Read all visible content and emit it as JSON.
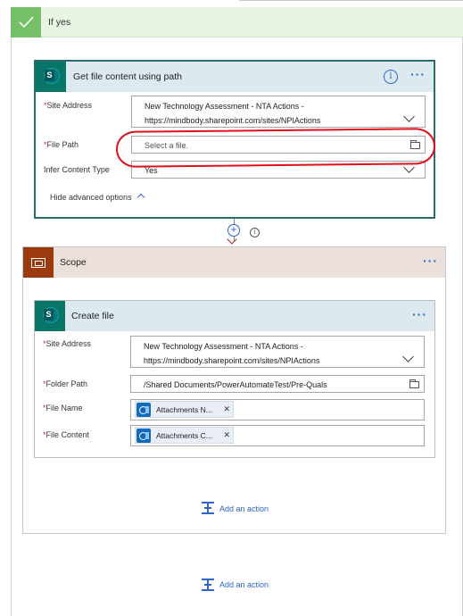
{
  "if_yes": {
    "title": "If yes"
  },
  "get_file_content": {
    "title": "Get file content using path",
    "site_address_label": "Site Address",
    "site_address_line1": "New Technology Assessment - NTA Actions -",
    "site_address_line2": "https://mindbody.sharepoint.com/sites/NPIActions",
    "file_path_label": "File Path",
    "file_path_placeholder": "Select a file.",
    "infer_label": "Infer Content Type",
    "infer_value": "Yes",
    "advanced_link": "Hide advanced options"
  },
  "scope": {
    "title": "Scope"
  },
  "create_file": {
    "title": "Create file",
    "site_address_label": "Site Address",
    "site_address_line1": "New Technology Assessment - NTA Actions -",
    "site_address_line2": "https://mindbody.sharepoint.com/sites/NPIActions",
    "folder_path_label": "Folder Path",
    "folder_path_value": "/Shared Documents/PowerAutomateTest/Pre-Quals",
    "file_name_label": "File Name",
    "file_name_token": "Attachments N...",
    "file_content_label": "File Content",
    "file_content_token": "Attachments C..."
  },
  "actions": {
    "add_action_inner": "Add an action",
    "add_action_outer": "Add an action"
  },
  "icons": {
    "check": "checkmark-icon",
    "sharepoint": "sharepoint-icon",
    "info": "info-icon",
    "more": "more-icon",
    "chevron": "chevron-down-icon",
    "folder": "folder-icon",
    "plus": "plus-icon",
    "scope": "scope-icon",
    "outlook": "outlook-icon",
    "remove": "close-icon",
    "add_action": "add-action-icon"
  },
  "colors": {
    "accent_blue": "#2b66c8",
    "success_green": "#77c06a",
    "sharepoint_teal": "#077568",
    "scope_brown": "#9a3a0d",
    "annotation_red": "#e0101a"
  }
}
